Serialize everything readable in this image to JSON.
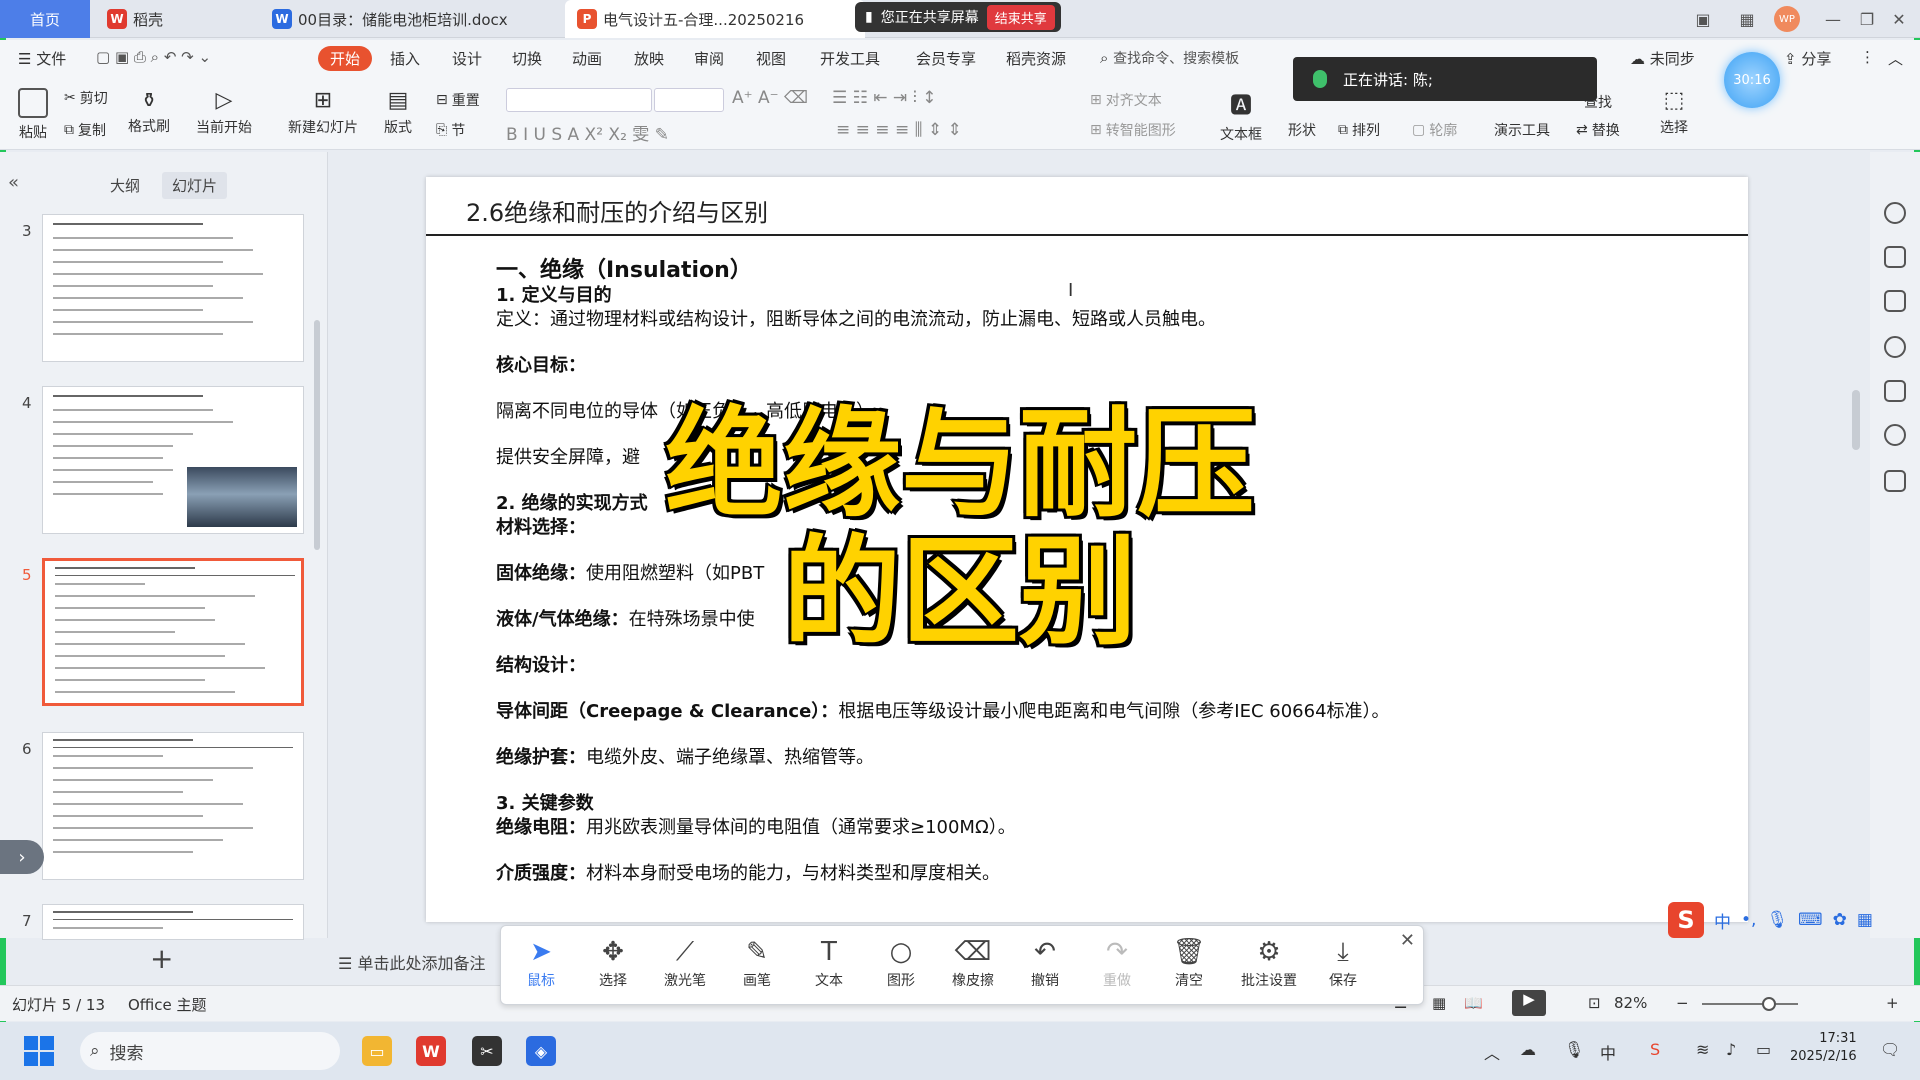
{
  "tabs": {
    "home": "首页",
    "daoke": "稻壳",
    "doc": "00目录：储能电池柜培训.docx",
    "ppt": "电气设计五-合理...20250216"
  },
  "share_pill": {
    "text": "您正在共享屏幕",
    "end": "结束共享"
  },
  "menu": {
    "file": "文件",
    "items": [
      "开始",
      "插入",
      "设计",
      "切换",
      "动画",
      "放映",
      "审阅",
      "视图",
      "开发工具",
      "会员专享",
      "稻壳资源"
    ],
    "search": "查找命令、搜索模板",
    "unsync": "未同步",
    "share": "分享"
  },
  "ribbon": {
    "paste": "粘贴",
    "cut": "剪切",
    "copy": "复制",
    "format_painter": "格式刷",
    "from_current": "当前开始",
    "new_slide": "新建幻灯片",
    "layout": "版式",
    "section": "节",
    "reset": "重置",
    "align_text": "对齐文本",
    "smartart": "转智能图形",
    "textbox": "文本框",
    "shape": "形状",
    "arrange": "排列",
    "outline": "轮廓",
    "present_tools": "演示工具",
    "replace": "替换",
    "select": "选择",
    "find": "查找"
  },
  "speaking": {
    "label": "正在讲话:",
    "name": "陈;"
  },
  "timer": "30:16",
  "left_panel": {
    "tabs": [
      "大纲",
      "幻灯片"
    ],
    "thumb_numbers": [
      "3",
      "4",
      "5",
      "6",
      "7"
    ],
    "add": "+"
  },
  "slide": {
    "title": "2.6绝缘和耐压的介绍与区别",
    "h1": "一、绝缘（Insulation）",
    "s1": "1. 定义与目的",
    "def": "定义：通过物理材料或结构设计，阻断导体之间的电流流动，防止漏电、短路或人员触电。",
    "core": "核心目标：",
    "core1": "隔离不同电位的导体（如正负极、高低压电路）。",
    "core2": "提供安全屏障，避",
    "s2": "2. 绝缘的实现方式",
    "material": "材料选择：",
    "solid_label": "固体绝缘：",
    "solid": "使用阻燃塑料（如PBT",
    "liquid_label": "液体/气体绝缘：",
    "liquid": "在特殊场景中使",
    "struct": "结构设计：",
    "gap_label": "导体间距（Creepage & Clearance）：",
    "gap": "根据电压等级设计最小爬电距离和电气间隙（参考IEC 60664标准）。",
    "sheath_label": "绝缘护套：",
    "sheath": "电缆外皮、端子绝缘罩、热缩管等。",
    "s3": "3. 关键参数",
    "res_label": "绝缘电阻：",
    "res": "用兆欧表测量导体间的电阻值（通常要求≥100MΩ）。",
    "diel_label": "介质强度：",
    "diel": "材料本身耐受电场的能力，与材料类型和厚度相关。"
  },
  "caption": {
    "line1": "绝缘与耐压",
    "line2": "的区别"
  },
  "annot_tools": [
    "鼠标",
    "选择",
    "激光笔",
    "画笔",
    "文本",
    "图形",
    "橡皮擦",
    "撤销",
    "重做",
    "清空",
    "批注设置",
    "保存"
  ],
  "notes_placeholder": "单击此处添加备注",
  "status": {
    "slide": "幻灯片 5 / 13",
    "theme": "Office 主题",
    "zoom": "82%"
  },
  "taskbar": {
    "search": "搜索",
    "time": "17:31",
    "date": "2025/2/16"
  },
  "ime": {
    "lang": "中"
  },
  "colors": {
    "accent": "#e8522f",
    "selected_thumb": "#f05a3a",
    "caption": "#ffd200",
    "share_end": "#e0393e"
  }
}
